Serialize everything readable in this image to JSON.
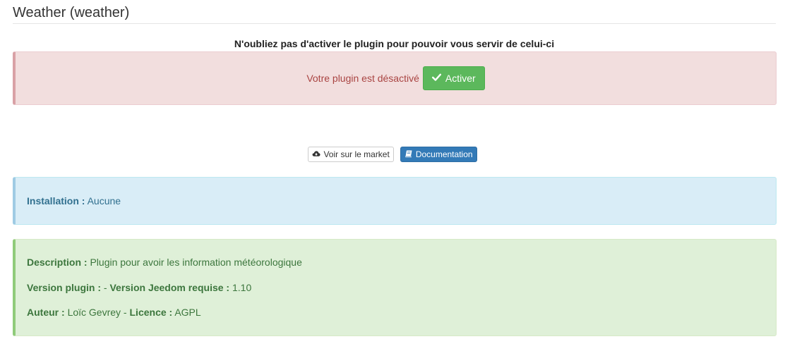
{
  "page_title": "Weather (weather)",
  "reminder": "N'oubliez pas d'activer le plugin pour pouvoir vous servir de celui-ci",
  "status_alert": {
    "message": "Votre plugin est désactivé",
    "activate_label": "Activer",
    "activate_icon": "check-icon"
  },
  "links": {
    "market_label": "Voir sur le market",
    "market_icon": "cloud-download-icon",
    "doc_label": "Documentation",
    "doc_icon": "book-icon"
  },
  "installation": {
    "label": "Installation :",
    "value": "Aucune"
  },
  "info": {
    "description_label": "Description :",
    "description_value": "Plugin pour avoir les information météorologique",
    "version_plugin_label": "Version plugin :",
    "version_plugin_value": "-",
    "version_jeedom_label": "Version Jeedom requise :",
    "version_jeedom_value": "1.10",
    "author_label": "Auteur :",
    "author_value": "Loïc Gevrey",
    "license_label": "Licence :",
    "license_value": "AGPL"
  },
  "colors": {
    "danger_bg": "#f2dede",
    "success_button": "#5cb85c",
    "primary_button": "#337ab7",
    "info_bg": "#d9edf7",
    "success_bg": "#dff0d8"
  }
}
